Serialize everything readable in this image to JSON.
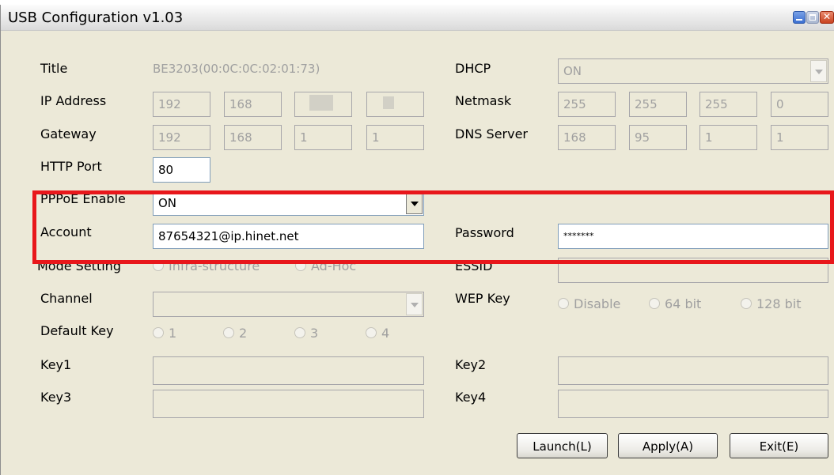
{
  "window": {
    "title": "USB Configuration v1.03"
  },
  "labels": {
    "title": "Title",
    "ip_address": "IP Address",
    "gateway": "Gateway",
    "http_port": "HTTP Port",
    "pppoe_enable": "PPPoE Enable",
    "account": "Account",
    "mode_setting": "Mode Setting",
    "channel": "Channel",
    "default_key": "Default Key",
    "key1": "Key1",
    "key3": "Key3",
    "dhcp": "DHCP",
    "netmask": "Netmask",
    "dns_server": "DNS Server",
    "password": "Password",
    "essid": "ESSID",
    "wep_key": "WEP Key",
    "key2": "Key2",
    "key4": "Key4"
  },
  "values": {
    "title": "BE3203(00:0C:0C:02:01:73)",
    "ip_address": [
      "192",
      "168",
      "",
      ""
    ],
    "gateway": [
      "192",
      "168",
      "1",
      "1"
    ],
    "http_port": "80",
    "pppoe_enable": "ON",
    "account": "87654321@ip.hinet.net",
    "dhcp": "ON",
    "netmask": [
      "255",
      "255",
      "255",
      "0"
    ],
    "dns_server": [
      "168",
      "95",
      "1",
      "1"
    ],
    "password": "*******",
    "channel": "",
    "essid": "",
    "key1": "",
    "key2": "",
    "key3": "",
    "key4": ""
  },
  "radios": {
    "mode": [
      "Infra-structure",
      "Ad-Hoc"
    ],
    "default_key": [
      "1",
      "2",
      "3",
      "4"
    ],
    "wep_key": [
      "Disable",
      "64 bit",
      "128 bit"
    ]
  },
  "buttons": {
    "launch": "Launch(L)",
    "apply": "Apply(A)",
    "exit": "Exit(E)"
  },
  "colors": {
    "highlight_box": "#e8171b",
    "dialog_bg": "#ece9d8"
  }
}
